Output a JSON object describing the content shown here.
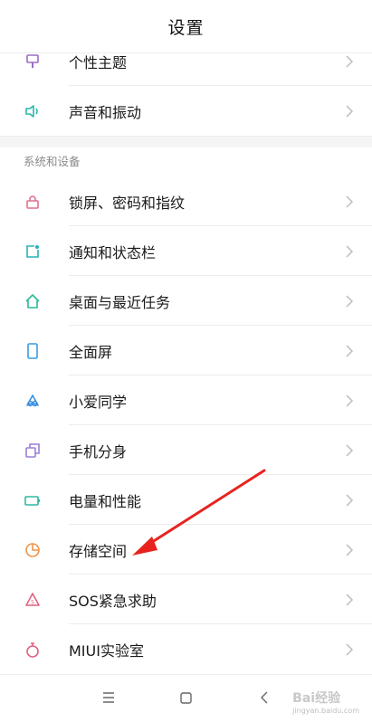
{
  "header": {
    "title": "设置"
  },
  "top_items": [
    {
      "label": "个性主题",
      "icon": "brush-icon",
      "color": "#9b6cc9"
    },
    {
      "label": "声音和振动",
      "icon": "speaker-icon",
      "color": "#2bb5a8"
    }
  ],
  "section": {
    "title": "系统和设备"
  },
  "system_items": [
    {
      "label": "锁屏、密码和指纹",
      "icon": "lock-icon",
      "color": "#e36f8d"
    },
    {
      "label": "通知和状态栏",
      "icon": "notification-icon",
      "color": "#27b3b6"
    },
    {
      "label": "桌面与最近任务",
      "icon": "home-icon",
      "color": "#2fb89a"
    },
    {
      "label": "全面屏",
      "icon": "phone-screen-icon",
      "color": "#3a9be0"
    },
    {
      "label": "小爱同学",
      "icon": "xiaoai-icon",
      "color": "#3a8fe0"
    },
    {
      "label": "手机分身",
      "icon": "dual-space-icon",
      "color": "#9a7fd6"
    },
    {
      "label": "电量和性能",
      "icon": "battery-icon",
      "color": "#2fb8a0"
    },
    {
      "label": "存储空间",
      "icon": "storage-pie-icon",
      "color": "#f0954a"
    },
    {
      "label": "SOS紧急求助",
      "icon": "sos-icon",
      "color": "#e3617e"
    },
    {
      "label": "MIUI实验室",
      "icon": "lab-flask-icon",
      "color": "#e3617e"
    }
  ],
  "navbar": {
    "menu_icon": "menu-icon",
    "home_icon": "home-square-icon",
    "back_icon": "back-icon"
  },
  "watermark": {
    "text": "Bai经验",
    "sub": "jingyan.baidu.com"
  }
}
